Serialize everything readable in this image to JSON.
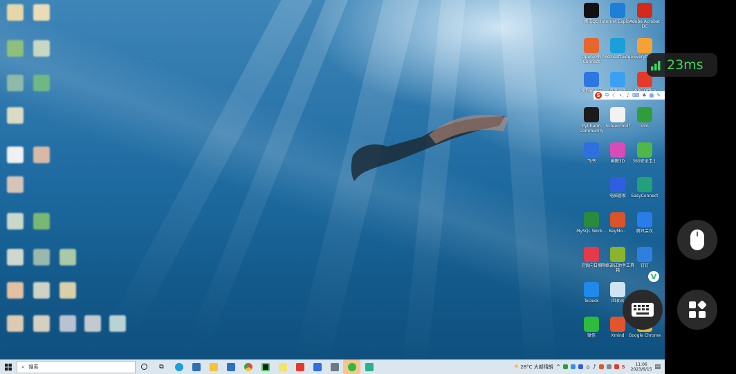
{
  "overlay": {
    "latency": "23ms",
    "signal_icon": "signal-bars-icon",
    "mouse_icon": "mouse-icon",
    "keyboard_icon": "keyboard-icon",
    "apps_icon": "apps-grid-icon"
  },
  "desktop_icons": [
    {
      "id": "qq",
      "label": "腾讯QQ",
      "icon": "qq-penguin-icon",
      "color": "#111111"
    },
    {
      "id": "ie",
      "label": "Internet Explorer",
      "icon": "ie-icon",
      "color": "#1e7fd6"
    },
    {
      "id": "acrobat",
      "label": "Adobe Acrobat DC",
      "icon": "acrobat-icon",
      "color": "#d42a1c"
    },
    {
      "id": "openvpn",
      "label": "OpenVPN Connect",
      "icon": "openvpn-icon",
      "color": "#e5672b"
    },
    {
      "id": "edge",
      "label": "Microsoft Edge",
      "icon": "edge-icon",
      "color": "#1a9fd8"
    },
    {
      "id": "app6",
      "label": "Everything",
      "icon": "search-app-icon",
      "color": "#f4a235"
    },
    {
      "id": "sogou",
      "label": "搜狗输入法",
      "icon": "sogou-icon",
      "color": "#2d78e0"
    },
    {
      "id": "baidu",
      "label": "百度网盘",
      "icon": "cloud-icon",
      "color": "#3aa0f2"
    },
    {
      "id": "wps",
      "label": "WPS Office",
      "icon": "wps-icon",
      "color": "#e43a2b"
    },
    {
      "id": "pycharm",
      "label": "PyCharm Community",
      "icon": "pycharm-icon",
      "color": "#1b1b1b"
    },
    {
      "id": "screentogif",
      "label": "ScreenToGif",
      "icon": "screentogif-icon",
      "color": "#f2f2f2"
    },
    {
      "id": "vim",
      "label": "Vim",
      "icon": "vim-icon",
      "color": "#2f9e3a"
    },
    {
      "id": "feishu",
      "label": "飞书",
      "icon": "feishu-icon",
      "color": "#2f6fe0"
    },
    {
      "id": "colors",
      "label": "画图3D",
      "icon": "paint-icon",
      "color": "#d94bb6"
    },
    {
      "id": "security",
      "label": "360安全卫士",
      "icon": "security-icon",
      "color": "#4fb848"
    },
    {
      "id": "vpnguard",
      "label": "电脑管家",
      "icon": "shield-icon",
      "color": "#2f5fe0"
    },
    {
      "id": "easyconnect",
      "label": "EasyConnect",
      "icon": "easyconnect-icon",
      "color": "#23a07a"
    },
    {
      "id": "mydesk",
      "label": "MySQL Work...",
      "icon": "db-icon",
      "color": "#2c8a3c"
    },
    {
      "id": "keymon",
      "label": "KeyMo...",
      "icon": "key-icon",
      "color": "#d9542b"
    },
    {
      "id": "tencentmeeting",
      "label": "腾讯会议",
      "icon": "meeting-icon",
      "color": "#2a7de8"
    },
    {
      "id": "tomato",
      "label": "贝锐向日葵",
      "icon": "remote-icon",
      "color": "#e43a4b"
    },
    {
      "id": "tools",
      "label": "网络调试助手工具箱",
      "icon": "tools-icon",
      "color": "#8ab42e"
    },
    {
      "id": "dingtalk",
      "label": "钉钉",
      "icon": "dingtalk-icon",
      "color": "#2f7fe0"
    },
    {
      "id": "todesk",
      "label": "ToDesk",
      "icon": "todesk-icon",
      "color": "#1f8ae8"
    },
    {
      "id": "recycle",
      "label": "回收站",
      "icon": "recycle-bin-icon",
      "color": "#cfe3f0"
    },
    {
      "id": "vue",
      "label": "",
      "icon": "vue-icon",
      "color": "#3fb27f"
    },
    {
      "id": "wechat",
      "label": "微信",
      "icon": "wechat-icon",
      "color": "#2dbb3c"
    },
    {
      "id": "xmind",
      "label": "Xmind",
      "icon": "xmind-icon",
      "color": "#e2542b"
    },
    {
      "id": "chrome",
      "label": "Google Chrome",
      "icon": "chrome-icon",
      "color": "#e2b53b"
    }
  ],
  "taskbar": {
    "search_placeholder": "搜索",
    "weather": "28°C 大部晴朗",
    "time": "11:06",
    "date": "2023/6/15"
  }
}
